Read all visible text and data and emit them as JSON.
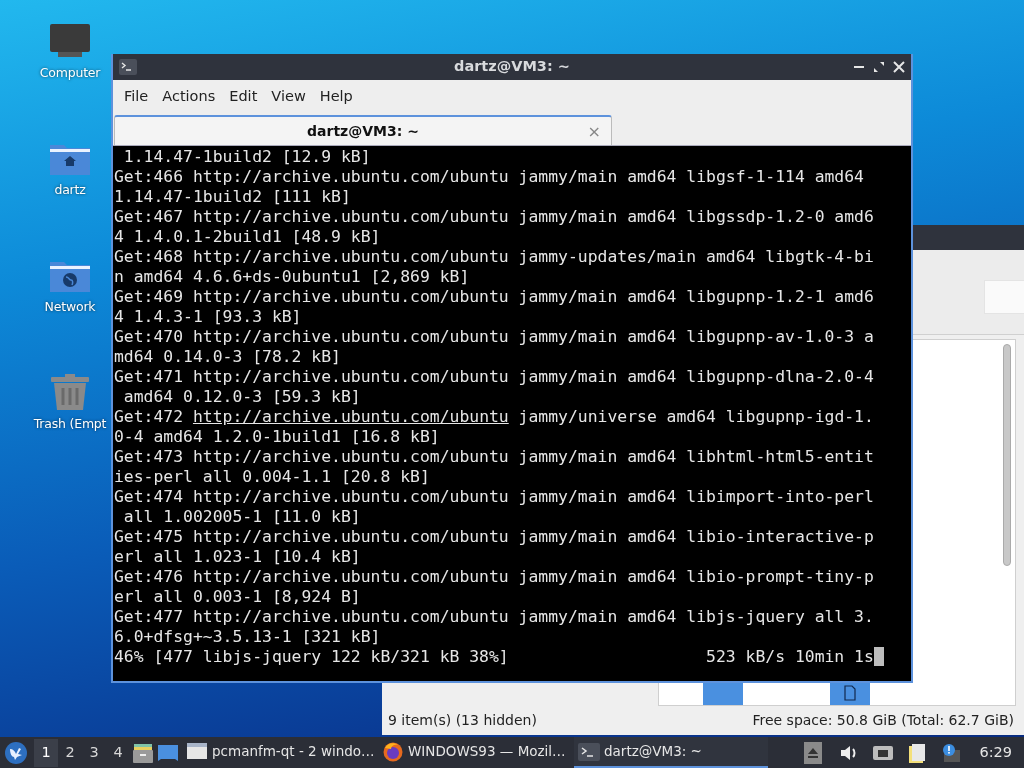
{
  "desktop_icons": [
    {
      "label": "Computer",
      "kind": "computer"
    },
    {
      "label": "dartz",
      "kind": "home"
    },
    {
      "label": "Network",
      "kind": "network"
    },
    {
      "label": "Trash (Empt",
      "kind": "trash"
    }
  ],
  "file_manager": {
    "status_left": "9 item(s) (13 hidden)",
    "status_right": "Free space: 50.8 GiB (Total: 62.7 GiB)"
  },
  "terminal": {
    "title": "dartz@VM3: ~",
    "menu": [
      "File",
      "Actions",
      "Edit",
      "View",
      "Help"
    ],
    "tabs": [
      {
        "label": "dartz@VM3: ~",
        "selected": true,
        "close": "×"
      }
    ],
    "lines": [
      {
        "text": " 1.14.47-1build2 [12.9 kB]"
      },
      {
        "text": "Get:466 http://archive.ubuntu.com/ubuntu jammy/main amd64 libgsf-1-114 amd64"
      },
      {
        "text": "1.14.47-1build2 [111 kB]"
      },
      {
        "text": "Get:467 http://archive.ubuntu.com/ubuntu jammy/main amd64 libgssdp-1.2-0 amd6"
      },
      {
        "text": "4 1.4.0.1-2build1 [48.9 kB]"
      },
      {
        "text": "Get:468 http://archive.ubuntu.com/ubuntu jammy-updates/main amd64 libgtk-4-bi"
      },
      {
        "text": "n amd64 4.6.6+ds-0ubuntu1 [2,869 kB]"
      },
      {
        "text": "Get:469 http://archive.ubuntu.com/ubuntu jammy/main amd64 libgupnp-1.2-1 amd6"
      },
      {
        "text": "4 1.4.3-1 [93.3 kB]"
      },
      {
        "text": "Get:470 http://archive.ubuntu.com/ubuntu jammy/main amd64 libgupnp-av-1.0-3 a"
      },
      {
        "text": "md64 0.14.0-3 [78.2 kB]"
      },
      {
        "text": "Get:471 http://archive.ubuntu.com/ubuntu jammy/main amd64 libgupnp-dlna-2.0-4"
      },
      {
        "text": " amd64 0.12.0-3 [59.3 kB]"
      },
      {
        "segments": [
          {
            "text": "Get:472 ",
            "underlined": false
          },
          {
            "text": "http://archive.ubuntu.com/ubuntu",
            "underlined": true
          },
          {
            "text": " jammy/universe amd64 libgupnp-igd-1.",
            "underlined": false
          }
        ]
      },
      {
        "text": "0-4 amd64 1.2.0-1build1 [16.8 kB]"
      },
      {
        "text": "Get:473 http://archive.ubuntu.com/ubuntu jammy/main amd64 libhtml-html5-entit"
      },
      {
        "text": "ies-perl all 0.004-1.1 [20.8 kB]"
      },
      {
        "text": "Get:474 http://archive.ubuntu.com/ubuntu jammy/main amd64 libimport-into-perl"
      },
      {
        "text": " all 1.002005-1 [11.0 kB]"
      },
      {
        "text": "Get:475 http://archive.ubuntu.com/ubuntu jammy/main amd64 libio-interactive-p"
      },
      {
        "text": "erl all 1.023-1 [10.4 kB]"
      },
      {
        "text": "Get:476 http://archive.ubuntu.com/ubuntu jammy/main amd64 libio-prompt-tiny-p"
      },
      {
        "text": "erl all 0.003-1 [8,924 B]"
      },
      {
        "text": "Get:477 http://archive.ubuntu.com/ubuntu jammy/main amd64 libjs-jquery all 3."
      },
      {
        "text": "6.0+dfsg+~3.5.13-1 [321 kB]"
      }
    ],
    "progress": "46% [477 libjs-jquery 122 kB/321 kB 38%]",
    "rate": "523 kB/s 10min 1s"
  },
  "taskbar": {
    "workspaces": [
      {
        "label": "1",
        "selected": true
      },
      {
        "label": "2",
        "selected": false
      },
      {
        "label": "3",
        "selected": false
      },
      {
        "label": "4",
        "selected": false
      }
    ],
    "tasks": [
      {
        "label": "pcmanfm-qt - 2 windo…",
        "kind": "files",
        "selected": false
      },
      {
        "label": "WINDOWS93 — Mozil…",
        "kind": "browser",
        "selected": false
      },
      {
        "label": "dartz@VM3: ~",
        "kind": "terminal",
        "selected": true
      }
    ],
    "clock": "6:29"
  }
}
